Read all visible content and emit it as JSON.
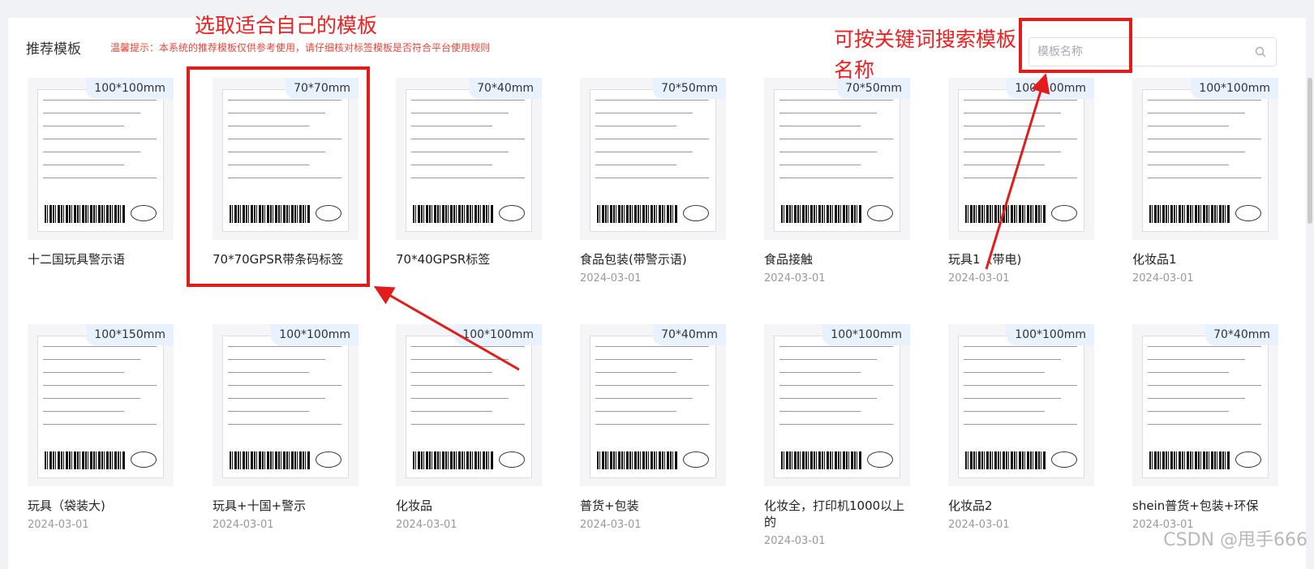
{
  "header": {
    "title": "推荐模板",
    "hint": "温馨提示：本系统的推荐模板仅供参考使用，请仔细核对标签模板是否符合平台使用规则"
  },
  "search": {
    "placeholder": "模板名称",
    "icon": "search-icon"
  },
  "annotations": {
    "choose_template": "选取适合自己的模板",
    "search_by_keyword": "可按关键词搜索模板名称"
  },
  "watermark": "CSDN @甩手666",
  "accent_colors": {
    "annotation_red": "#e21b1b",
    "hint_red": "#e8463a",
    "tag_bg": "#e8f1fe"
  },
  "rows": [
    [
      {
        "size": "100*100mm",
        "name": "十二国玩具警示语",
        "date": ""
      },
      {
        "size": "70*70mm",
        "name": "70*70GPSR带条码标签",
        "date": ""
      },
      {
        "size": "70*40mm",
        "name": "70*40GPSR标签",
        "date": ""
      },
      {
        "size": "70*50mm",
        "name": "食品包装(带警示语)",
        "date": "2024-03-01"
      },
      {
        "size": "70*50mm",
        "name": "食品接触",
        "date": "2024-03-01"
      },
      {
        "size": "100*100mm",
        "name": "玩具1（带电)",
        "date": "2024-03-01"
      },
      {
        "size": "100*100mm",
        "name": "化妆品1",
        "date": "2024-03-01"
      }
    ],
    [
      {
        "size": "100*150mm",
        "name": "玩具（袋装大)",
        "date": "2024-03-01"
      },
      {
        "size": "100*100mm",
        "name": "玩具+十国+警示",
        "date": "2024-03-01"
      },
      {
        "size": "100*100mm",
        "name": "化妆品",
        "date": "2024-03-01"
      },
      {
        "size": "70*40mm",
        "name": "普货+包装",
        "date": "2024-03-01"
      },
      {
        "size": "100*100mm",
        "name": "化妆全，打印机1000以上的",
        "date": "2024-03-01"
      },
      {
        "size": "100*100mm",
        "name": "化妆品2",
        "date": "2024-03-01"
      },
      {
        "size": "70*40mm",
        "name": "shein普货+包装+环保",
        "date": "2024-03-01"
      }
    ]
  ]
}
